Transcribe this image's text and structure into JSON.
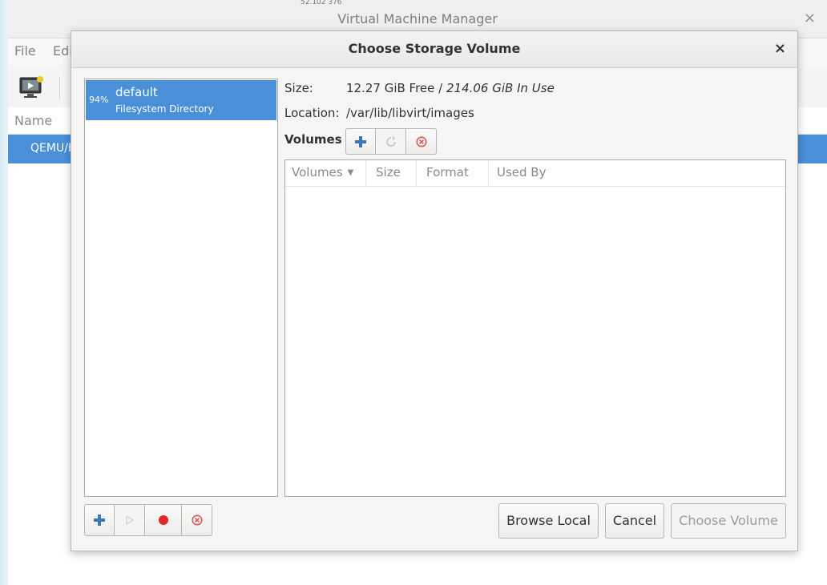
{
  "main": {
    "window_title": "Virtual Machine Manager",
    "top_strip_text": "52.102 376",
    "close_icon": "×",
    "menu": [
      "File",
      "Edi"
    ],
    "list_header": "Name",
    "selected_row": "QEMU/K"
  },
  "dialog": {
    "title": "Choose Storage Volume",
    "close_icon": "×",
    "pool": {
      "percent": "94%",
      "name": "default",
      "type": "Filesystem Directory"
    },
    "size_label": "Size:",
    "size_free": "12.27 GiB Free / ",
    "size_in_use": "214.06 GiB In Use",
    "location_label": "Location:",
    "location_value": "/var/lib/libvirt/images",
    "volumes_label": "Volumes",
    "columns": [
      "Volumes",
      "Size",
      "Format",
      "Used By"
    ],
    "buttons": {
      "browse_local": "Browse Local",
      "cancel": "Cancel",
      "choose_volume": "Choose Volume"
    }
  },
  "colors": {
    "selection": "#4a90d9",
    "add_icon": "#3c76b8",
    "stop_icon": "#e22727",
    "delete_icon": "#d9534f"
  }
}
